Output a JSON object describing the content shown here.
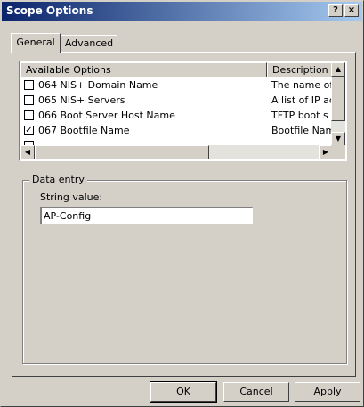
{
  "window": {
    "title": "Scope Options",
    "help_label": "?",
    "close_label": "×"
  },
  "tabs": [
    {
      "label": "General",
      "active": true
    },
    {
      "label": "Advanced",
      "active": false
    }
  ],
  "options_list": {
    "columns": [
      "Available Options",
      "Description"
    ],
    "rows": [
      {
        "checked": false,
        "option": "064 NIS+ Domain Name",
        "description": "The name of"
      },
      {
        "checked": false,
        "option": "065 NIS+ Servers",
        "description": "A list of IP ac"
      },
      {
        "checked": false,
        "option": "066 Boot Server Host Name",
        "description": "TFTP boot s"
      },
      {
        "checked": true,
        "option": "067 Bootfile Name",
        "description": "Bootfile Nam"
      }
    ]
  },
  "data_entry": {
    "group_label": "Data entry",
    "field_label": "String value:",
    "field_value": "AP-Config"
  },
  "buttons": {
    "ok": "OK",
    "cancel": "Cancel",
    "apply": "Apply"
  }
}
